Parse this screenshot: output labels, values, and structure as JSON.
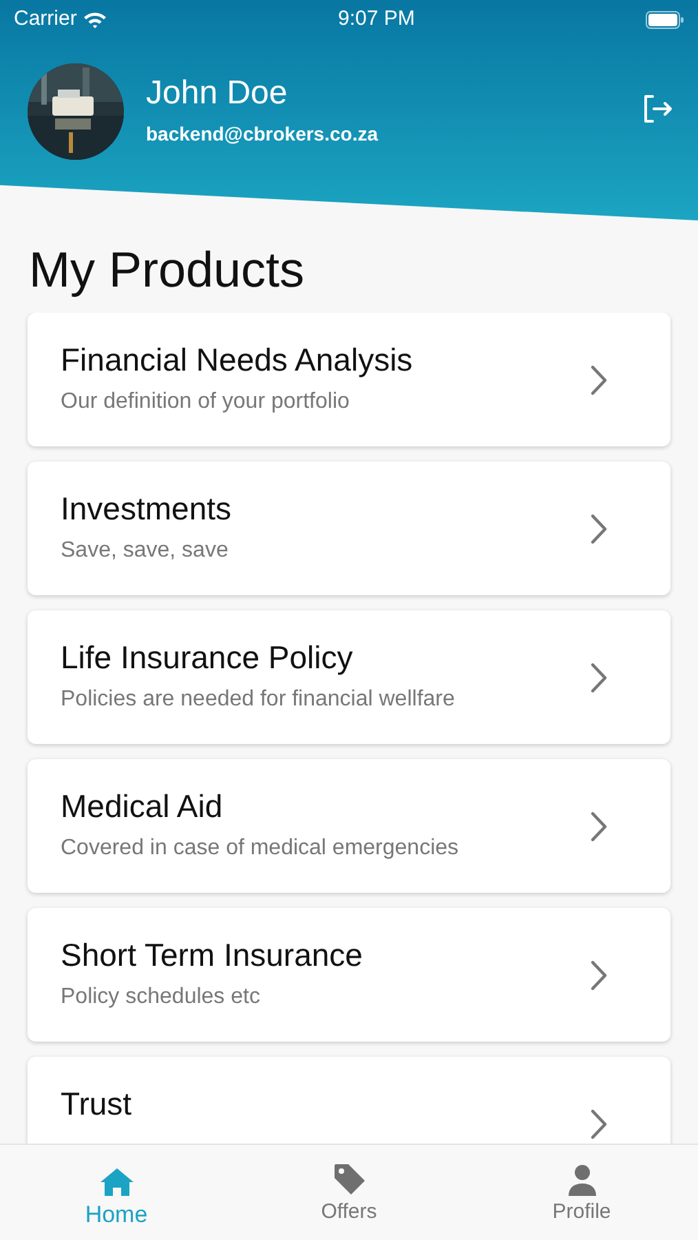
{
  "status_bar": {
    "carrier": "Carrier",
    "time": "9:07 PM"
  },
  "profile": {
    "name": "John Doe",
    "email": "backend@cbrokers.co.za"
  },
  "title": "My Products",
  "products": [
    {
      "title": "Financial Needs Analysis",
      "subtitle": "Our definition of your portfolio"
    },
    {
      "title": "Investments",
      "subtitle": "Save, save, save"
    },
    {
      "title": "Life Insurance Policy",
      "subtitle": "Policies are needed for financial wellfare"
    },
    {
      "title": "Medical Aid",
      "subtitle": "Covered in case of medical emergencies"
    },
    {
      "title": "Short Term Insurance",
      "subtitle": "Policy schedules etc"
    },
    {
      "title": "Trust"
    }
  ],
  "tabs": [
    {
      "label": "Home",
      "kind": "home",
      "selected": true
    },
    {
      "label": "Offers",
      "kind": "tag",
      "selected": false
    },
    {
      "label": "Profile",
      "kind": "person",
      "selected": false
    }
  ]
}
